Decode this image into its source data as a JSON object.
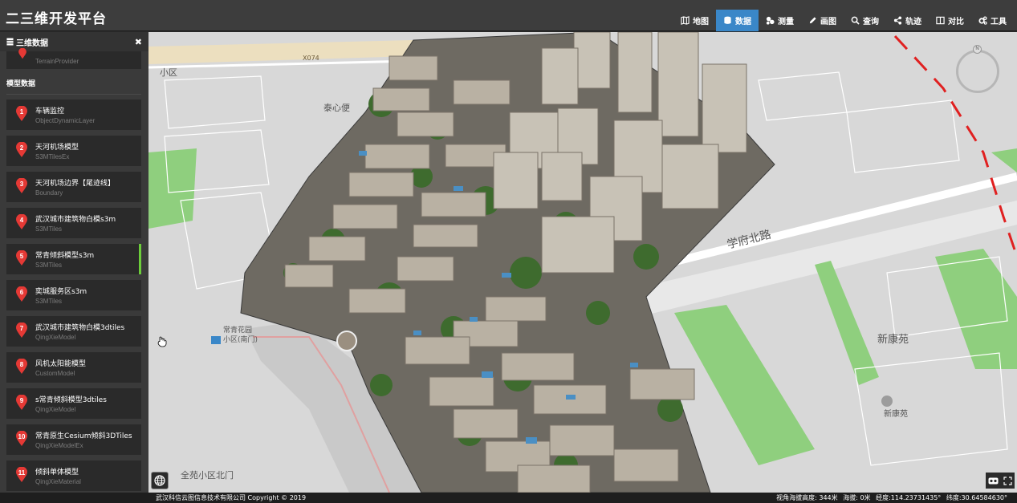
{
  "app": {
    "title": "二三维开发平台"
  },
  "nav": [
    {
      "label": "地图",
      "icon": "map-icon",
      "active": false
    },
    {
      "label": "数据",
      "icon": "database-icon",
      "active": true
    },
    {
      "label": "测量",
      "icon": "measure-icon",
      "active": false
    },
    {
      "label": "画图",
      "icon": "pencil-icon",
      "active": false
    },
    {
      "label": "查询",
      "icon": "search-icon",
      "active": false
    },
    {
      "label": "轨迹",
      "icon": "share-icon",
      "active": false
    },
    {
      "label": "对比",
      "icon": "columns-icon",
      "active": false
    },
    {
      "label": "工具",
      "icon": "gears-icon",
      "active": false
    }
  ],
  "sidebar": {
    "title": "三维数据",
    "close": "✖",
    "terrain_type": "TerrainProvider",
    "section_title": "模型数据",
    "items": [
      {
        "num": "1",
        "name": "车辆监控",
        "type": "ObjectDynamicLayer"
      },
      {
        "num": "2",
        "name": "天河机场模型",
        "type": "S3MTilesEx"
      },
      {
        "num": "3",
        "name": "天河机场边界【尾迹线】",
        "type": "Boundary"
      },
      {
        "num": "4",
        "name": "武汉城市建筑物白模s3m",
        "type": "S3MTiles"
      },
      {
        "num": "5",
        "name": "常青倾斜模型s3m",
        "type": "S3MTiles",
        "selected": true
      },
      {
        "num": "6",
        "name": "奕城服务区s3m",
        "type": "S3MTiles"
      },
      {
        "num": "7",
        "name": "武汉城市建筑物白模3dtiles",
        "type": "QingXieModel"
      },
      {
        "num": "8",
        "name": "风机太阳能模型",
        "type": "CustomModel"
      },
      {
        "num": "9",
        "name": "s常青倾斜模型3dtiles",
        "type": "QingXieModel"
      },
      {
        "num": "10",
        "name": "常青原生Cesium倾斜3DTiles",
        "type": "QingXieModelEx"
      },
      {
        "num": "11",
        "name": "倾斜单体模型",
        "type": "QingXieMaterial"
      }
    ]
  },
  "map": {
    "labels": {
      "road_x074": "X074",
      "district_top": "小区",
      "xuefu_road": "学府北路",
      "xinkangyuan": "新康苑",
      "xinkangyuan_poi": "新康苑",
      "changqing_garden": "常青花园",
      "changqing_garden_2": "小区(南门)",
      "quanyuan_north_gate": "全苑小区北门",
      "north_side": "泰心便"
    }
  },
  "status": {
    "copyright": "武汉科信云图信息技术有限公司 Copyright © 2019",
    "view_height": "视角海拔高度: 344米",
    "altitude": "海拔: 0米",
    "longitude": "经度:114.23731435°",
    "latitude": "纬度:30.64584630°"
  }
}
